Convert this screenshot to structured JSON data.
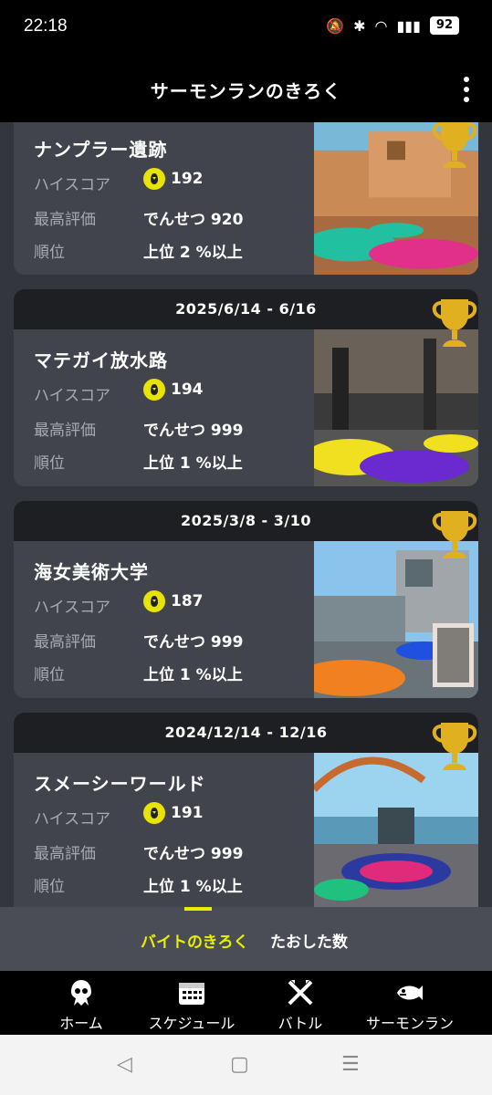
{
  "status": {
    "time": "22:18",
    "battery": "92"
  },
  "header": {
    "title": "サーモンランのきろく"
  },
  "cards": [
    {
      "date": "",
      "stage": "ナンプラー遺跡",
      "labels": {
        "highscore": "ハイスコア",
        "best": "最高評価",
        "rank": "順位"
      },
      "highscore": "192",
      "best": "でんせつ 920",
      "rank": "上位 2 %以上"
    },
    {
      "date": "2025/6/14 - 6/16",
      "stage": "マテガイ放水路",
      "labels": {
        "highscore": "ハイスコア",
        "best": "最高評価",
        "rank": "順位"
      },
      "highscore": "194",
      "best": "でんせつ 999",
      "rank": "上位 1 %以上"
    },
    {
      "date": "2025/3/8 - 3/10",
      "stage": "海女美術大学",
      "labels": {
        "highscore": "ハイスコア",
        "best": "最高評価",
        "rank": "順位"
      },
      "highscore": "187",
      "best": "でんせつ 999",
      "rank": "上位 1 %以上"
    },
    {
      "date": "2024/12/14 - 12/16",
      "stage": "スメーシーワールド",
      "labels": {
        "highscore": "ハイスコア",
        "best": "最高評価",
        "rank": "順位"
      },
      "highscore": "191",
      "best": "でんせつ 999",
      "rank": "上位 1 %以上"
    }
  ],
  "tabs": {
    "active": "バイトのきろく",
    "inactive": "たおした数"
  },
  "nav": {
    "home": "ホーム",
    "schedule": "スケジュール",
    "battle": "バトル",
    "salmon": "サーモンラン"
  },
  "colors": {
    "accent": "#e8f000",
    "trophy": "#e0b020",
    "card_bg": "#41444c",
    "date_bg": "#1e1f23"
  }
}
